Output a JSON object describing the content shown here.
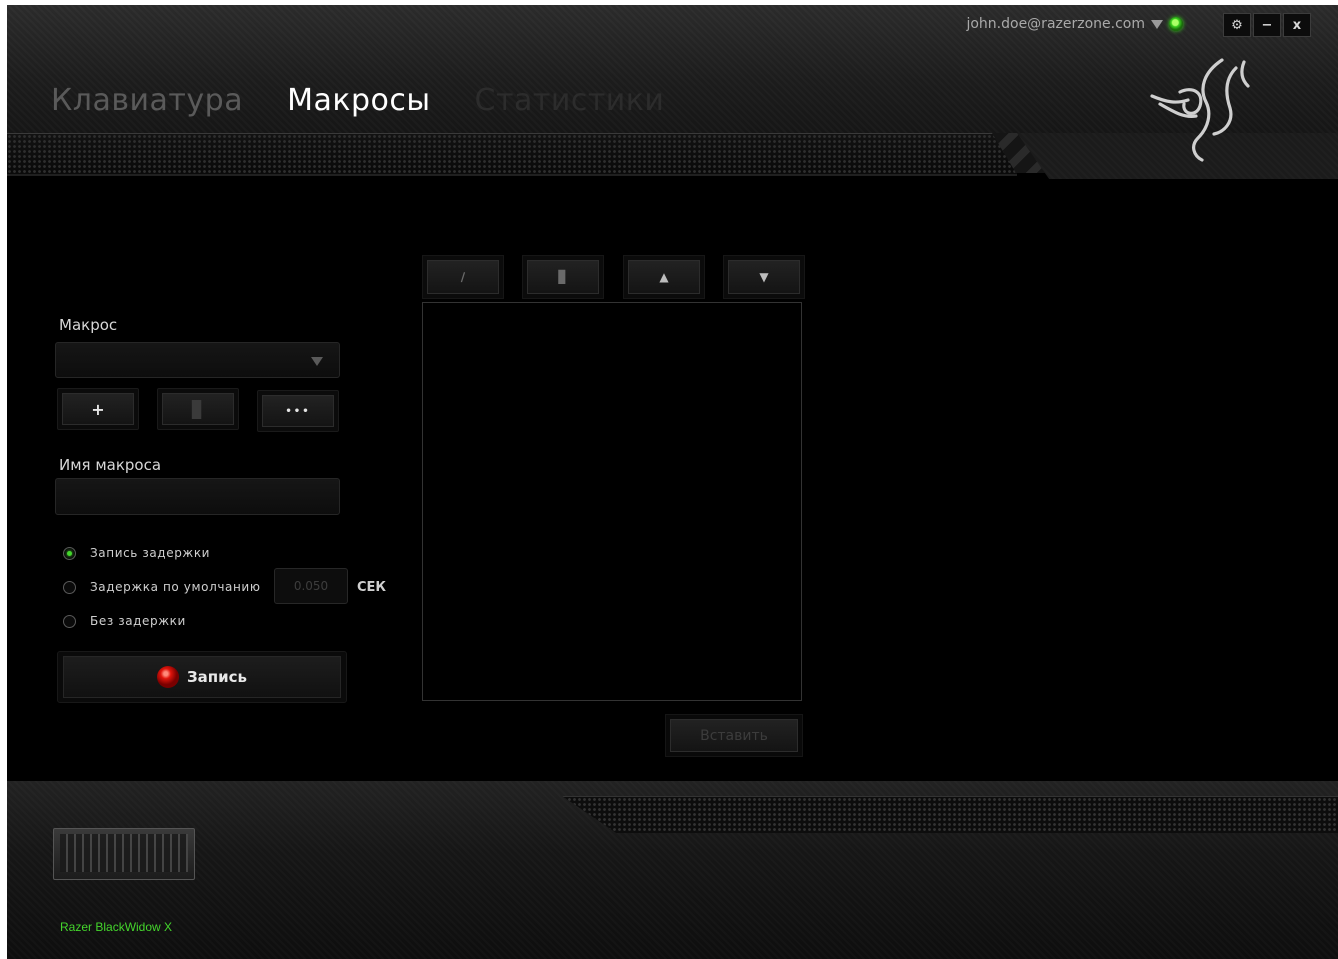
{
  "account": {
    "email": "john.doe@razerzone.com"
  },
  "window_controls": {
    "settings": "⚙",
    "minimize": "−",
    "close": "x"
  },
  "tabs": [
    {
      "label": "Клавиатура",
      "state": "inactive"
    },
    {
      "label": "Макросы",
      "state": "active"
    },
    {
      "label": "Статистики",
      "state": "faint"
    }
  ],
  "macro": {
    "label": "Макрос",
    "selected": "",
    "add_glyph": "+",
    "delete_glyph": "▊",
    "more_glyph": "•••"
  },
  "macro_name": {
    "label": "Имя макроса",
    "value": ""
  },
  "delay_options": [
    {
      "label": "Запись задержки",
      "checked": true
    },
    {
      "label": "Задержка по умолчанию",
      "checked": false
    },
    {
      "label": "Без задержки",
      "checked": false
    }
  ],
  "default_delay": {
    "value": "0.050",
    "unit": "СЕК"
  },
  "record_button": {
    "label": "Запись"
  },
  "editor_toolbar": {
    "edit_glyph": "∕",
    "delete_glyph": "▊",
    "up_glyph": "▲",
    "down_glyph": "▼"
  },
  "insert_button": {
    "label": "Вставить"
  },
  "device": {
    "name": "Razer BlackWidow X"
  },
  "colors": {
    "accent": "#44d62c",
    "record": "#e0150c",
    "background": "#000000"
  }
}
